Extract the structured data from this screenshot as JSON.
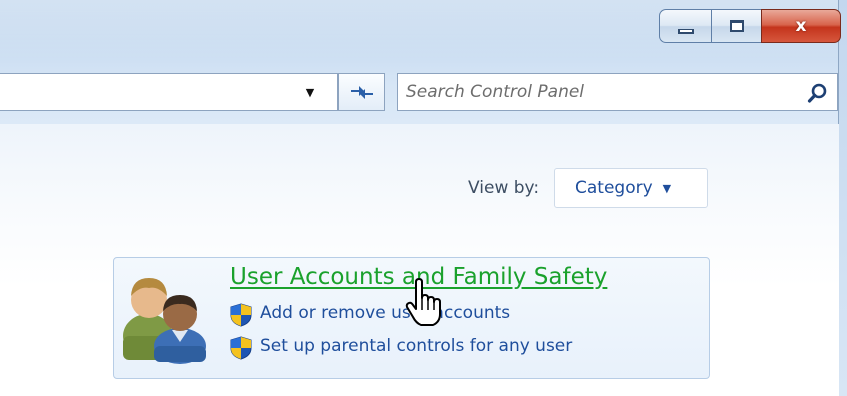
{
  "window": {
    "caption_buttons": {
      "minimize": "minimize",
      "maximize": "maximize",
      "close": "x"
    }
  },
  "address_bar": {
    "dropdown_icon": "chevron-down-icon",
    "refresh_icon": "refresh-icon"
  },
  "search": {
    "placeholder": "Search Control Panel",
    "value": "",
    "icon": "search-icon"
  },
  "view_by": {
    "label": "View by:",
    "selected": "Category"
  },
  "category": {
    "title": "User Accounts and Family Safety",
    "links": [
      {
        "label": "Add or remove user accounts",
        "icon": "shield-icon"
      },
      {
        "label": "Set up parental controls for any user",
        "icon": "shield-icon"
      }
    ],
    "icon": "users-icon"
  },
  "colors": {
    "link_green": "#1aa12c",
    "link_blue": "#1f4e9c",
    "close_red": "#c4341c"
  }
}
